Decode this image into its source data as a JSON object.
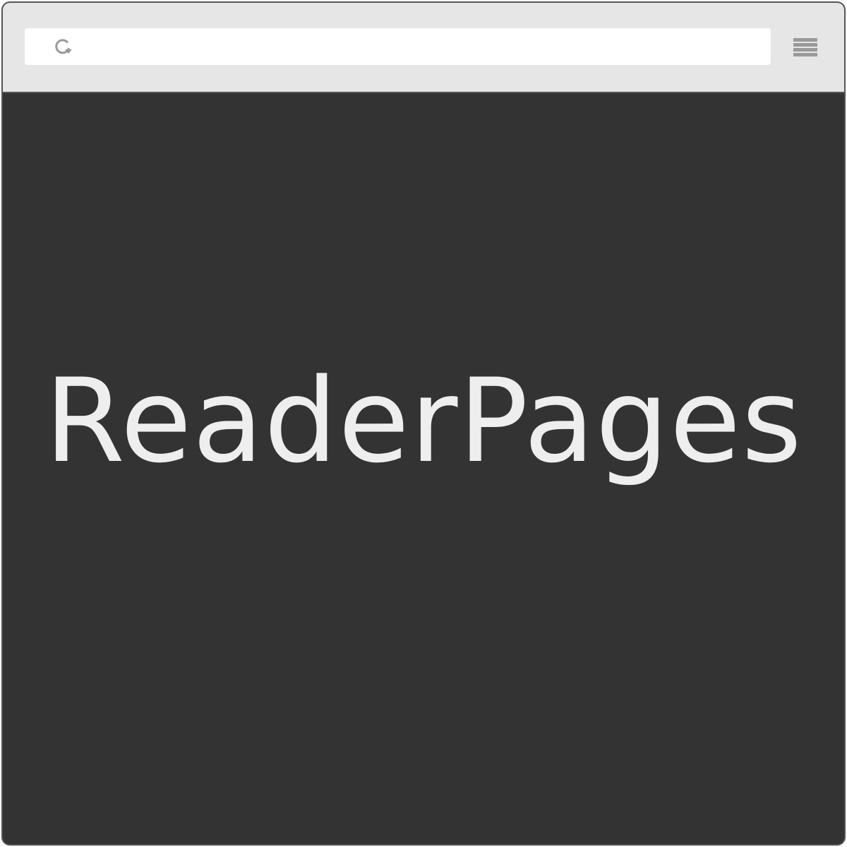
{
  "browser": {
    "address_value": "",
    "reload_icon": "reload-icon",
    "menu_icon": "hamburger-menu-icon"
  },
  "page": {
    "title": "ReaderPages"
  },
  "colors": {
    "toolbar_bg": "#e6e6e6",
    "content_bg": "#333333",
    "title_text": "#eeeeee",
    "icon": "#999999",
    "frame_border": "#555555"
  }
}
